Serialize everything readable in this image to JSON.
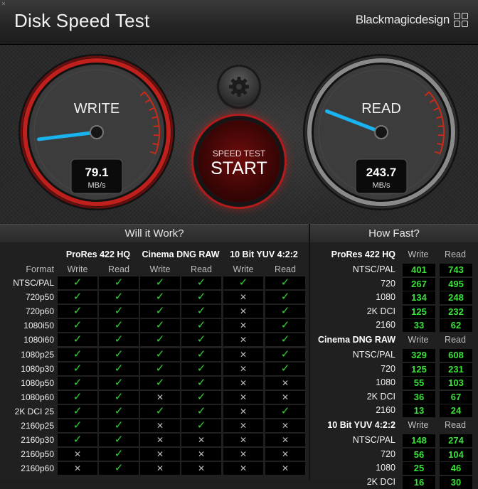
{
  "window": {
    "close_glyph": "×"
  },
  "header": {
    "title": "Disk Speed Test",
    "brand": "Blackmagicdesign"
  },
  "gauges": {
    "write": {
      "label": "WRITE",
      "value": "79.1",
      "unit": "MB/s",
      "needle_fraction": 0.11
    },
    "read": {
      "label": "READ",
      "value": "243.7",
      "unit": "MB/s",
      "needle_fraction": 0.22
    }
  },
  "start_button": {
    "small": "SPEED TEST",
    "big": "START"
  },
  "settings_icon": "gear-icon",
  "colors": {
    "needle": "#19b4f0",
    "write_ring": "#c0201c",
    "check": "#35d235",
    "speed_value": "#3ae23a"
  },
  "will_it_work": {
    "title": "Will it Work?",
    "format_label": "Format",
    "categories": [
      "ProRes 422 HQ",
      "Cinema DNG RAW",
      "10 Bit YUV 4:2:2"
    ],
    "sub_write": "Write",
    "sub_read": "Read",
    "rows": [
      {
        "format": "NTSC/PAL",
        "cells": [
          1,
          1,
          1,
          1,
          1,
          1
        ]
      },
      {
        "format": "720p50",
        "cells": [
          1,
          1,
          1,
          1,
          0,
          1
        ]
      },
      {
        "format": "720p60",
        "cells": [
          1,
          1,
          1,
          1,
          0,
          1
        ]
      },
      {
        "format": "1080i50",
        "cells": [
          1,
          1,
          1,
          1,
          0,
          1
        ]
      },
      {
        "format": "1080i60",
        "cells": [
          1,
          1,
          1,
          1,
          0,
          1
        ]
      },
      {
        "format": "1080p25",
        "cells": [
          1,
          1,
          1,
          1,
          0,
          1
        ]
      },
      {
        "format": "1080p30",
        "cells": [
          1,
          1,
          1,
          1,
          0,
          1
        ]
      },
      {
        "format": "1080p50",
        "cells": [
          1,
          1,
          1,
          1,
          0,
          0
        ]
      },
      {
        "format": "1080p60",
        "cells": [
          1,
          1,
          0,
          1,
          0,
          0
        ]
      },
      {
        "format": "2K DCI 25",
        "cells": [
          1,
          1,
          1,
          1,
          0,
          1
        ]
      },
      {
        "format": "2160p25",
        "cells": [
          1,
          1,
          0,
          1,
          0,
          0
        ]
      },
      {
        "format": "2160p30",
        "cells": [
          1,
          1,
          0,
          0,
          0,
          0
        ]
      },
      {
        "format": "2160p50",
        "cells": [
          0,
          1,
          0,
          0,
          0,
          0
        ]
      },
      {
        "format": "2160p60",
        "cells": [
          0,
          1,
          0,
          0,
          0,
          0
        ]
      }
    ]
  },
  "how_fast": {
    "title": "How Fast?",
    "groups": [
      {
        "name": "ProRes 422 HQ",
        "write": "Write",
        "read": "Read",
        "rows": [
          {
            "format": "NTSC/PAL",
            "write": "401",
            "read": "743"
          },
          {
            "format": "720",
            "write": "267",
            "read": "495"
          },
          {
            "format": "1080",
            "write": "134",
            "read": "248"
          },
          {
            "format": "2K DCI",
            "write": "125",
            "read": "232"
          },
          {
            "format": "2160",
            "write": "33",
            "read": "62"
          }
        ]
      },
      {
        "name": "Cinema DNG RAW",
        "write": "Write",
        "read": "Read",
        "rows": [
          {
            "format": "NTSC/PAL",
            "write": "329",
            "read": "608"
          },
          {
            "format": "720",
            "write": "125",
            "read": "231"
          },
          {
            "format": "1080",
            "write": "55",
            "read": "103"
          },
          {
            "format": "2K DCI",
            "write": "36",
            "read": "67"
          },
          {
            "format": "2160",
            "write": "13",
            "read": "24"
          }
        ]
      },
      {
        "name": "10 Bit YUV 4:2:2",
        "write": "Write",
        "read": "Read",
        "rows": [
          {
            "format": "NTSC/PAL",
            "write": "148",
            "read": "274"
          },
          {
            "format": "720",
            "write": "56",
            "read": "104"
          },
          {
            "format": "1080",
            "write": "25",
            "read": "46"
          },
          {
            "format": "2K DCI",
            "write": "16",
            "read": "30"
          }
        ]
      }
    ]
  }
}
